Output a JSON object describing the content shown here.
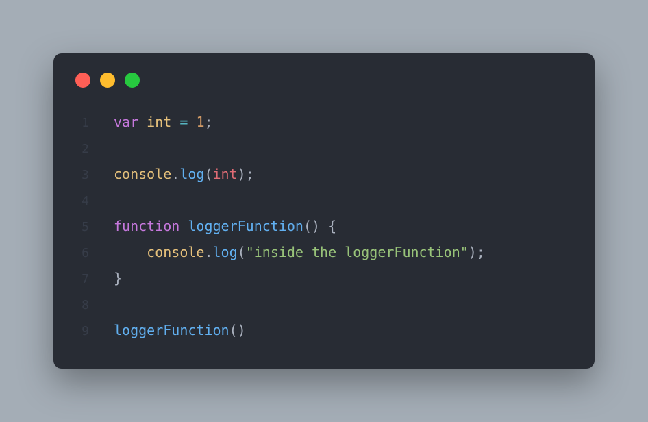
{
  "window": {
    "traffic_lights": [
      "close",
      "minimize",
      "zoom"
    ]
  },
  "colors": {
    "bg": "#a4adb6",
    "editor_bg": "#282c34",
    "red": "#ff5f56",
    "yellow": "#ffbd2e",
    "green": "#27c93f",
    "keyword": "#c678dd",
    "variable": "#e5c07b",
    "operator": "#56b6c2",
    "number": "#d19a66",
    "default": "#abb2bf",
    "method": "#61afef",
    "param": "#e06c75",
    "string": "#98c379",
    "line_number": "#495162"
  },
  "code": {
    "lines": [
      {
        "num": "1",
        "tokens": [
          {
            "cls": "tk-keyword",
            "text": "var"
          },
          {
            "cls": "tk-default",
            "text": " "
          },
          {
            "cls": "tk-variable",
            "text": "int"
          },
          {
            "cls": "tk-default",
            "text": " "
          },
          {
            "cls": "tk-operator",
            "text": "="
          },
          {
            "cls": "tk-default",
            "text": " "
          },
          {
            "cls": "tk-number",
            "text": "1"
          },
          {
            "cls": "tk-punct",
            "text": ";"
          }
        ]
      },
      {
        "num": "2",
        "tokens": []
      },
      {
        "num": "3",
        "tokens": [
          {
            "cls": "tk-object",
            "text": "console"
          },
          {
            "cls": "tk-punct",
            "text": "."
          },
          {
            "cls": "tk-method",
            "text": "log"
          },
          {
            "cls": "tk-paren",
            "text": "("
          },
          {
            "cls": "tk-param",
            "text": "int"
          },
          {
            "cls": "tk-paren",
            "text": ")"
          },
          {
            "cls": "tk-punct",
            "text": ";"
          }
        ]
      },
      {
        "num": "4",
        "tokens": []
      },
      {
        "num": "5",
        "tokens": [
          {
            "cls": "tk-keyword",
            "text": "function"
          },
          {
            "cls": "tk-default",
            "text": " "
          },
          {
            "cls": "tk-funcname",
            "text": "loggerFunction"
          },
          {
            "cls": "tk-paren",
            "text": "("
          },
          {
            "cls": "tk-paren",
            "text": ")"
          },
          {
            "cls": "tk-default",
            "text": " "
          },
          {
            "cls": "tk-brace",
            "text": "{"
          }
        ]
      },
      {
        "num": "6",
        "tokens": [
          {
            "cls": "tk-default",
            "text": "    "
          },
          {
            "cls": "tk-object",
            "text": "console"
          },
          {
            "cls": "tk-punct",
            "text": "."
          },
          {
            "cls": "tk-method",
            "text": "log"
          },
          {
            "cls": "tk-paren",
            "text": "("
          },
          {
            "cls": "tk-string",
            "text": "\"inside the loggerFunction\""
          },
          {
            "cls": "tk-paren",
            "text": ")"
          },
          {
            "cls": "tk-punct",
            "text": ";"
          }
        ]
      },
      {
        "num": "7",
        "tokens": [
          {
            "cls": "tk-brace",
            "text": "}"
          }
        ]
      },
      {
        "num": "8",
        "tokens": []
      },
      {
        "num": "9",
        "tokens": [
          {
            "cls": "tk-funcname",
            "text": "loggerFunction"
          },
          {
            "cls": "tk-paren",
            "text": "("
          },
          {
            "cls": "tk-paren",
            "text": ")"
          }
        ]
      }
    ]
  }
}
